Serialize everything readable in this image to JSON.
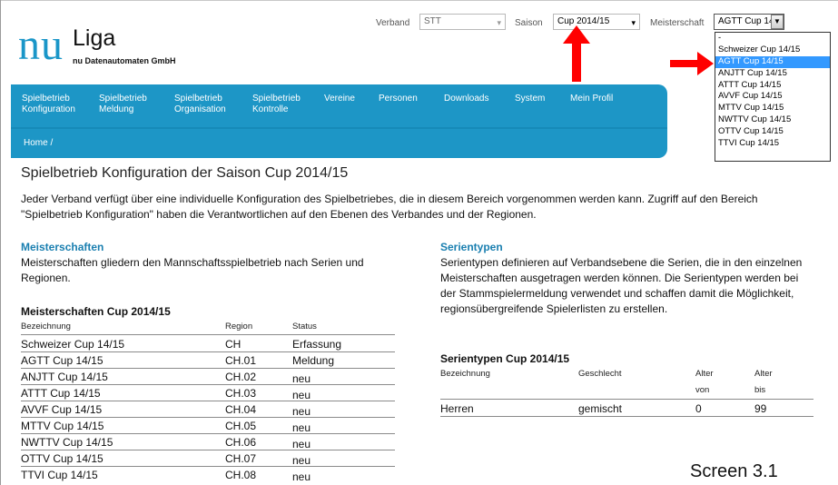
{
  "logo": {
    "nu": "nu",
    "liga": "Liga",
    "subtitle": "nu Datenautomaten GmbH"
  },
  "filters": {
    "verband_label": "Verband",
    "verband_value": "STT",
    "saison_label": "Saison",
    "saison_value": "Cup 2014/15",
    "meisterschaft_label": "Meisterschaft",
    "meisterschaft_value": "AGTT Cup 14,",
    "meisterschaft_options": [
      "-",
      "Schweizer Cup 14/15",
      "AGTT Cup 14/15",
      "ANJTT Cup 14/15",
      "ATTT Cup 14/15",
      "AVVF Cup 14/15",
      "MTTV Cup 14/15",
      "NWTTV Cup 14/15",
      "OTTV Cup 14/15",
      "TTVI Cup 14/15"
    ],
    "selected_option": "AGTT Cup 14/15"
  },
  "nav": {
    "items": [
      {
        "line1": "Spielbetrieb",
        "line2": "Konfiguration"
      },
      {
        "line1": "Spielbetrieb",
        "line2": "Meldung"
      },
      {
        "line1": "Spielbetrieb",
        "line2": "Organisation"
      },
      {
        "line1": "Spielbetrieb",
        "line2": "Kontrolle"
      },
      {
        "line1": "Vereine",
        "line2": ""
      },
      {
        "line1": "Personen",
        "line2": ""
      },
      {
        "line1": "Downloads",
        "line2": ""
      },
      {
        "line1": "System",
        "line2": ""
      },
      {
        "line1": "Mein Profil",
        "line2": ""
      }
    ],
    "breadcrumb": "Home /"
  },
  "page": {
    "title": "Spielbetrieb Konfiguration der Saison Cup 2014/15",
    "intro": "Jeder Verband verfügt über eine individuelle Konfiguration des Spielbetriebes, die in diesem Bereich vorgenommen werden kann. Zugriff auf den Bereich \"Spielbetrieb Konfiguration\" haben die Verantwortlichen auf den Ebenen des Verbandes und der Regionen."
  },
  "meisterschaften": {
    "heading": "Meisterschaften",
    "description": "Meisterschaften gliedern den Mannschaftsspielbetrieb nach Serien und Regionen.",
    "table_title": "Meisterschaften Cup 2014/15",
    "columns": [
      "Bezeichnung",
      "Region",
      "Status"
    ],
    "rows": [
      [
        "Schweizer Cup 14/15",
        "CH",
        "Erfassung"
      ],
      [
        "AGTT Cup 14/15",
        "CH.01",
        "Meldung"
      ],
      [
        "ANJTT Cup 14/15",
        "CH.02",
        "neu"
      ],
      [
        "ATTT Cup 14/15",
        "CH.03",
        "neu"
      ],
      [
        "AVVF Cup 14/15",
        "CH.04",
        "neu"
      ],
      [
        "MTTV Cup 14/15",
        "CH.05",
        "neu"
      ],
      [
        "NWTTV Cup 14/15",
        "CH.06",
        "neu"
      ],
      [
        "OTTV Cup 14/15",
        "CH.07",
        "neu"
      ],
      [
        "TTVI Cup 14/15",
        "CH.08",
        "neu"
      ]
    ]
  },
  "serientypen": {
    "heading": "Serientypen",
    "description": "Serientypen definieren auf Verbandsebene die Serien, die in den einzelnen Meisterschaften ausgetragen werden können. Die Serientypen werden bei der Stammspielermeldung verwendet und schaffen damit die Möglichkeit, regionsübergreifende Spielerlisten zu erstellen.",
    "table_title": "Serientypen Cup 2014/15",
    "columns": [
      "Bezeichnung",
      "Geschlecht",
      "Alter",
      "Alter"
    ],
    "columns_sub": [
      "",
      "",
      "von",
      "bis"
    ],
    "rows": [
      [
        "Herren",
        "gemischt",
        "0",
        "99"
      ]
    ]
  },
  "caption": "Screen 3.1",
  "colors": {
    "accent": "#1d96c6",
    "highlight": "#3399ff",
    "arrow": "#ff0000"
  }
}
